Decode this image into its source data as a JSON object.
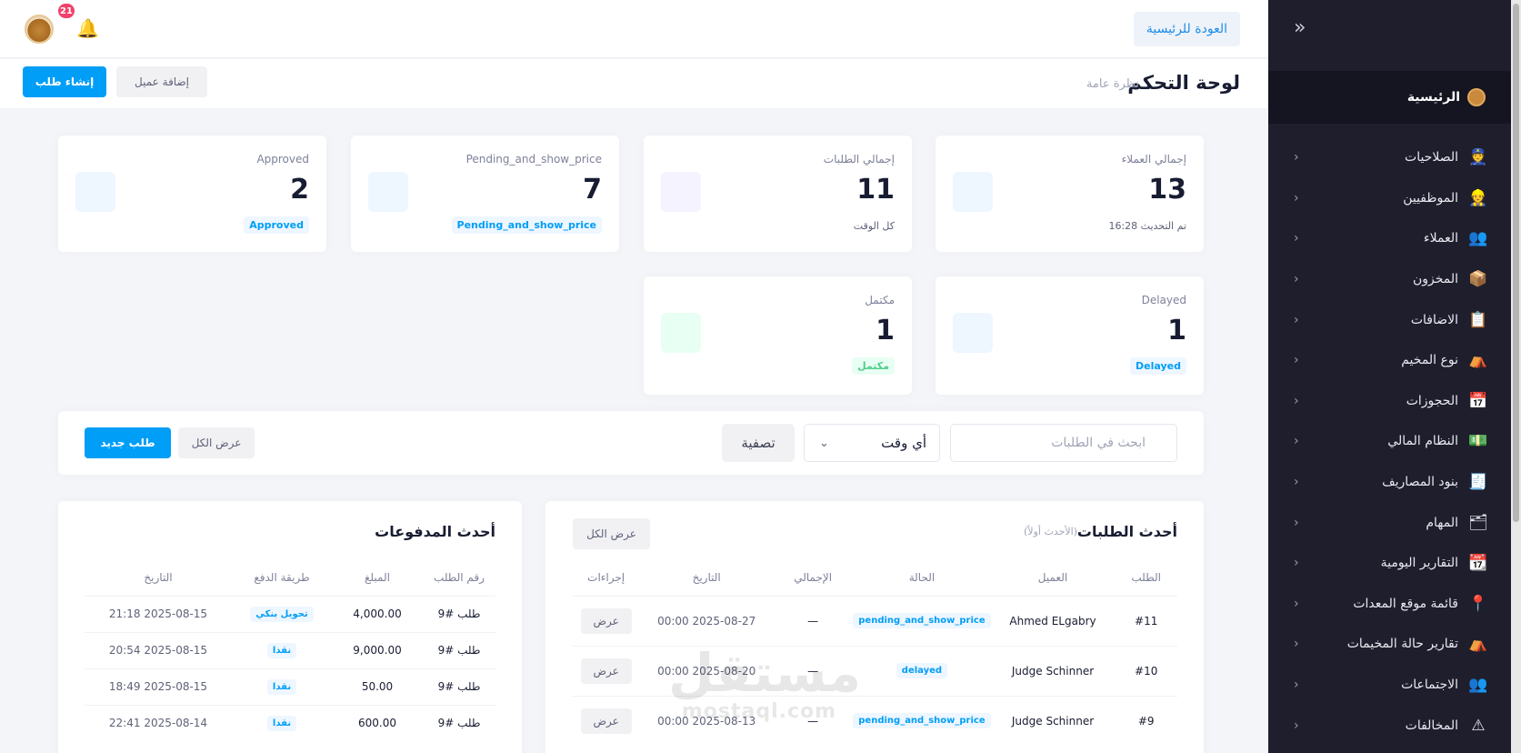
{
  "sidebar": {
    "home_label": "الرئيسية",
    "items": [
      {
        "label": "الصلاحيات",
        "icon": "permissions-icon",
        "glyph": "👮"
      },
      {
        "label": "الموظفيين",
        "icon": "employees-icon",
        "glyph": "👷"
      },
      {
        "label": "العملاء",
        "icon": "customers-icon",
        "glyph": "👥"
      },
      {
        "label": "المخزون",
        "icon": "inventory-icon",
        "glyph": "📦"
      },
      {
        "label": "الاضافات",
        "icon": "additions-icon",
        "glyph": "📋"
      },
      {
        "label": "نوع المخيم",
        "icon": "camp-type-icon",
        "glyph": "⛺"
      },
      {
        "label": "الحجوزات",
        "icon": "bookings-icon",
        "glyph": "📅"
      },
      {
        "label": "النظام المالي",
        "icon": "finance-icon",
        "glyph": "💵"
      },
      {
        "label": "بنود المصاريف",
        "icon": "expenses-icon",
        "glyph": "🧾"
      },
      {
        "label": "المهام",
        "icon": "tasks-icon",
        "glyph": "🗂"
      },
      {
        "label": "التقارير اليومية",
        "icon": "daily-reports-icon",
        "glyph": "📆"
      },
      {
        "label": "قائمة موقع المعدات",
        "icon": "equipment-location-icon",
        "glyph": "📍"
      },
      {
        "label": "تقارير حالة المخيمات",
        "icon": "camp-status-reports-icon",
        "glyph": "⛺"
      },
      {
        "label": "الاجتماعات",
        "icon": "meetings-icon",
        "glyph": "👥"
      },
      {
        "label": "المخالفات",
        "icon": "violations-icon",
        "glyph": "⚠"
      }
    ]
  },
  "topbar": {
    "back_label": "العودة للرئيسية",
    "notifications_count": "21"
  },
  "page": {
    "title": "لوحة التحكم",
    "subtitle": "نظرة عامة",
    "create_order_label": "إنشاء طلب",
    "add_customer_label": "إضافة عميل"
  },
  "stats": {
    "customers": {
      "title": "إجمالي العملاء",
      "value": "13",
      "foot": "تم التحديث 16:28"
    },
    "orders": {
      "title": "إجمالي الطلبات",
      "value": "11",
      "foot": "كل الوقت"
    },
    "pending": {
      "title": "Pending_and_show_price",
      "value": "7",
      "badge": "Pending_and_show_price"
    },
    "approved": {
      "title": "Approved",
      "value": "2",
      "badge": "Approved"
    },
    "delayed": {
      "title": "Delayed",
      "value": "1",
      "badge": "Delayed"
    },
    "completed": {
      "title": "مكتمل",
      "value": "1",
      "badge": "مكتمل"
    }
  },
  "filters": {
    "search_placeholder": "ابحث في الطلبات",
    "time_value": "أي وقت",
    "filter_label": "تصفية",
    "view_all_label": "عرض الكل",
    "new_order_label": "طلب جديد"
  },
  "recent_orders": {
    "title": "أحدث الطلبات",
    "note": "(الأحدث أولاً)",
    "view_all_label": "عرض الكل",
    "columns": [
      "الطلب",
      "العميل",
      "الحالة",
      "الإجمالي",
      "التاريخ",
      "إجراءات"
    ],
    "rows": [
      {
        "id": "#11",
        "customer": "Ahmed ELgabry",
        "status": "pending_and_show_price",
        "total": "—",
        "date": "2025-08-27 00:00",
        "action": "عرض"
      },
      {
        "id": "#10",
        "customer": "Judge Schinner",
        "status": "delayed",
        "total": "—",
        "date": "2025-08-20 00:00",
        "action": "عرض"
      },
      {
        "id": "#9",
        "customer": "Judge Schinner",
        "status": "pending_and_show_price",
        "total": "—",
        "date": "2025-08-13 00:00",
        "action": "عرض"
      }
    ]
  },
  "recent_payments": {
    "title": "أحدث المدفوعات",
    "columns": [
      "رقم الطلب",
      "المبلغ",
      "طريقة الدفع",
      "التاريخ"
    ],
    "rows": [
      {
        "order": "طلب #9",
        "amount": "4,000.00",
        "method": "تحويل بنكي",
        "date": "2025-08-15 21:18"
      },
      {
        "order": "طلب #9",
        "amount": "9,000.00",
        "method": "نقدا",
        "date": "2025-08-15 20:54"
      },
      {
        "order": "طلب #9",
        "amount": "50.00",
        "method": "نقدا",
        "date": "2025-08-15 18:49"
      },
      {
        "order": "طلب #9",
        "amount": "600.00",
        "method": "نقدا",
        "date": "2025-08-14 22:41"
      }
    ]
  },
  "watermark": {
    "line1": "مستقل",
    "line2": "mostaql.com"
  },
  "colors": {
    "primary": "#009ef7",
    "sidebar": "#1e1e2d",
    "danger": "#f1416c",
    "success": "#50cd89"
  }
}
